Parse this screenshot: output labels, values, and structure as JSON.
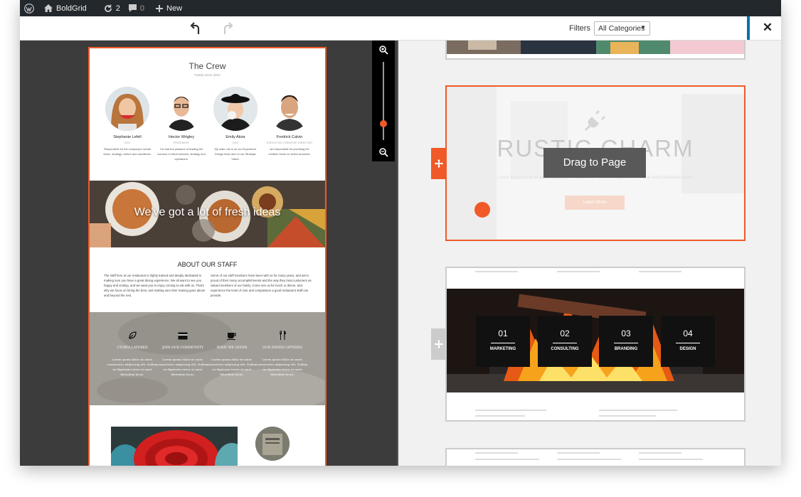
{
  "admin_bar": {
    "site_name": "BoldGrid",
    "updates_count": "2",
    "comments_count": "0",
    "new_label": "New"
  },
  "toolbar": {
    "filters_label": "Filters",
    "category_selected": "All Categories"
  },
  "preview": {
    "crew": {
      "title": "The Crew",
      "subtitle": "Family since 2012",
      "members": [
        {
          "name": "Stephanie Lefell",
          "role": "CEO",
          "bio": "Responsible for the company's overall vision, strategy, culture and operations."
        },
        {
          "name": "Hector Wrigley",
          "role": "PRESIDENT",
          "bio": "I've had the pleasure of leading the success of client services, strategy and operations."
        },
        {
          "name": "Emily Akira",
          "role": "COO",
          "bio": "My main role is on our Experience Design team and on our Strategic Vision."
        },
        {
          "name": "Fredrick Calvin",
          "role": "EXECUTIVE CREATIVE DIRECTOR",
          "bio": "am responsible for providing the creative vision on select accounts."
        }
      ]
    },
    "banner_text": "We've got a lot of fresh ideas",
    "about": {
      "title": "ABOUT OUR STAFF",
      "col1": "The staff here at our restaurant is highly trained and deeply dedicated to making sure you have a great dining experience. We all want to see you happy and smiling, and we want you to enjoy coming to eat with us. That's why we focus on hiring the best, and making sure their training goes above and beyond the rest.",
      "col2": "Some of our staff members have been with us for many years, and we're proud of their many accomplishments and the way they treat customers as valued members of our family. Come see us for lunch or dinner, and experience the level of care and compassion a good restaurant staff can provide."
    },
    "services": [
      {
        "title": "UTOPIA LAYERED",
        "icon": "leaf-icon",
        "text": "Lorem ipsum dolor sit amet, consectetur adipiscing elit. Nullam ex dignissim tortor at amet bibendum lacus."
      },
      {
        "title": "JOIN OUR COMMUNITY",
        "icon": "card-icon",
        "text": "Lorem ipsum dolor sit amet, consectetur adipiscing elit. Nullam ex dignissim tortor at amet bibendum lacus."
      },
      {
        "title": "WHAT WE OFFER",
        "icon": "cup-icon",
        "text": "Lorem ipsum dolor sit amet, consectetur adipiscing elit. Nullam ex dignissim tortor at amet bibendum lacus."
      },
      {
        "title": "OUR DINING OPTIONS",
        "icon": "utensils-icon",
        "text": "Lorem ipsum dolor sit amet, consectetur adipiscing elit. Nullam ex dignissim tortor at amet bibendum lacus."
      }
    ]
  },
  "blocks": {
    "rustic": {
      "heading": "RUSTIC CHARM",
      "subtext": "Lorem ipsum dolor sit amet, consectetur adipiscing elit. Nullam dignissim tortor at amet bibendum lacus.",
      "button": "Learn More",
      "drag_label": "Drag to Page",
      "icon": "plug-icon"
    },
    "fire": {
      "items": [
        {
          "num": "01",
          "label": "MARKETING"
        },
        {
          "num": "02",
          "label": "CONSULTING"
        },
        {
          "num": "03",
          "label": "BRANDING"
        },
        {
          "num": "04",
          "label": "DESIGN"
        }
      ]
    }
  },
  "colors": {
    "accent": "#f05a28",
    "admin_bar": "#23282d",
    "wp_blue": "#0073aa",
    "panel_dark": "#3c3c3c"
  }
}
